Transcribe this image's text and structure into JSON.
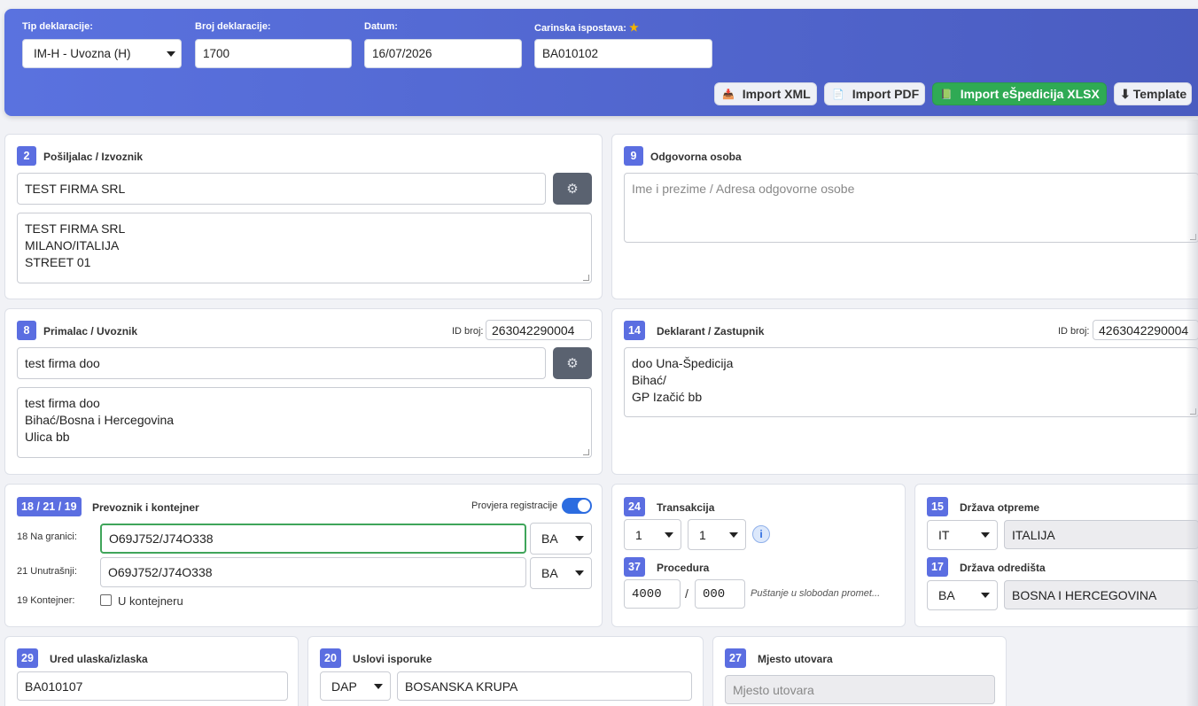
{
  "header": {
    "tip_label": "Tip deklaracije:",
    "tip_value": "IM-H - Uvozna (H)",
    "broj_label": "Broj deklaracije:",
    "broj_value": "1700",
    "datum_label": "Datum:",
    "datum_value": "16/07/2026",
    "ispostava_label": "Carinska ispostava:",
    "ispostava_value": "BA010102",
    "buttons": {
      "import_xml": "Import XML",
      "import_pdf": "Import PDF",
      "import_xlsx": "Import eŠpedicija XLSX",
      "template": "Template",
      "template_icon": "⬇"
    }
  },
  "posiljalac": {
    "badge": "2",
    "title": "Pošiljalac / Izvoznik",
    "name": "TEST FIRMA SRL",
    "address": "TEST FIRMA SRL\nMILANO/ITALIJA\nSTREET 01"
  },
  "odgovorna": {
    "badge": "9",
    "title": "Odgovorna osoba",
    "placeholder": "Ime i prezime / Adresa odgovorne osobe"
  },
  "primalac": {
    "badge": "8",
    "title": "Primalac / Uvoznik",
    "id_label": "ID broj:",
    "id_value": "263042290004",
    "name": "test firma doo",
    "address": "test firma doo\nBihać/Bosna i Hercegovina\nUlica bb"
  },
  "deklarant": {
    "badge": "14",
    "title": "Deklarant / Zastupnik",
    "id_label": "ID broj:",
    "id_value": "4263042290004",
    "address": "doo Una-Špedicija\nBihać/\nGP Izačić bb"
  },
  "prevoznik": {
    "badge": "18 / 21 / 19",
    "title": "Prevoznik i kontejner",
    "provjera_label": "Provjera registracije",
    "na_granici_label": "18 Na granici:",
    "na_granici_value": "O69J752/J74O338",
    "na_granici_country": "BA",
    "unutrasnji_label": "21 Unutrašnji:",
    "unutrasnji_value": "O69J752/J74O338",
    "unutrasnji_country": "BA",
    "kontejner_label": "19 Kontejner:",
    "u_kontejneru": "U kontejneru"
  },
  "transakcija": {
    "badge": "24",
    "title": "Transakcija",
    "val1": "1",
    "val2": "1",
    "info": "i"
  },
  "procedura": {
    "badge": "37",
    "title": "Procedura",
    "code1": "4000",
    "sep": "/",
    "code2": "000",
    "desc": "Puštanje u slobodan promet..."
  },
  "drzava_otpreme": {
    "badge": "15",
    "title": "Država otpreme",
    "code": "IT",
    "name": "ITALIJA"
  },
  "drzava_odredista": {
    "badge": "17",
    "title": "Država odredišta",
    "code": "BA",
    "name": "BOSNA I HERCEGOVINA"
  },
  "ured": {
    "badge": "29",
    "title": "Ured ulaska/izlaska",
    "value": "BA010107"
  },
  "uslovi": {
    "badge": "20",
    "title": "Uslovi isporuke",
    "code": "DAP",
    "place": "BOSANSKA KRUPA"
  },
  "mjesto": {
    "badge": "27",
    "title": "Mjesto utovara",
    "placeholder": "Mjesto utovara"
  },
  "icons": {
    "gear": "⚙",
    "star": "★"
  }
}
